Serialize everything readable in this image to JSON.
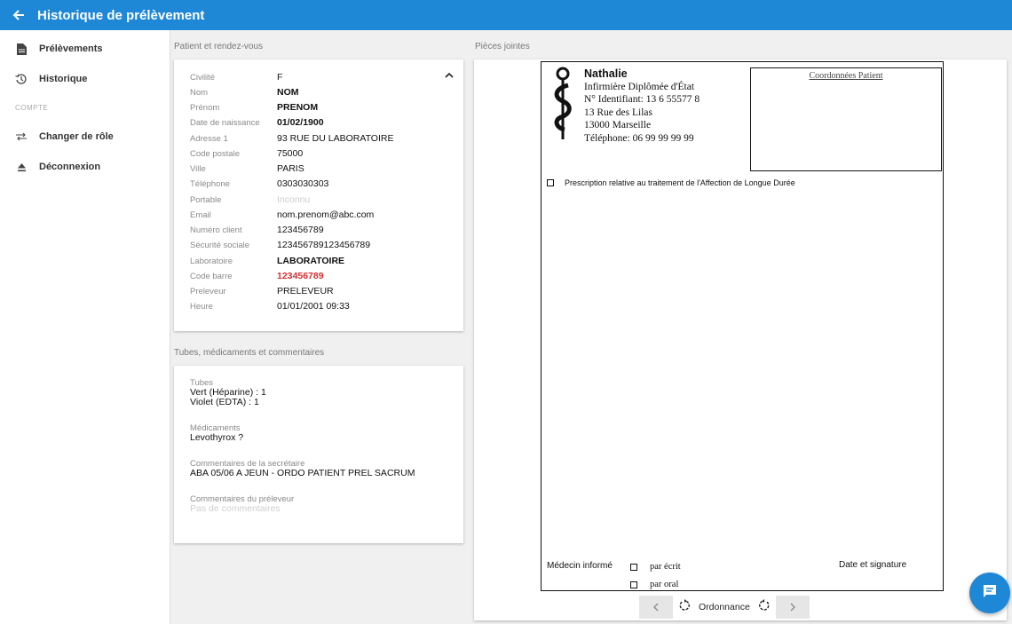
{
  "app": {
    "title": "Historique de prélèvement"
  },
  "sidebar": {
    "items": [
      {
        "label": "Prélèvements",
        "icon": "document-icon"
      },
      {
        "label": "Historique",
        "icon": "history-icon"
      }
    ],
    "section": "COMPTE",
    "account_items": [
      {
        "label": "Changer de rôle",
        "icon": "swap-icon"
      },
      {
        "label": "Déconnexion",
        "icon": "eject-icon"
      }
    ]
  },
  "patient": {
    "section_title": "Patient et rendez-vous",
    "fields": [
      {
        "label": "Civilité",
        "value": "F"
      },
      {
        "label": "Nom",
        "value": "NOM"
      },
      {
        "label": "Prénom",
        "value": "PRENOM"
      },
      {
        "label": "Date de naissance",
        "value": "01/02/1900"
      },
      {
        "label": "Adresse 1",
        "value": "93 RUE DU LABORATOIRE"
      },
      {
        "label": "Code postale",
        "value": "75000"
      },
      {
        "label": "Ville",
        "value": "PARIS"
      },
      {
        "label": "Téléphone",
        "value": "0303030303"
      },
      {
        "label": "Portable",
        "value": "Inconnu"
      },
      {
        "label": "Email",
        "value": "nom.prenom@abc.com"
      },
      {
        "label": "Numéro client",
        "value": "123456789"
      },
      {
        "label": "Sécurité sociale",
        "value": "123456789123456789"
      },
      {
        "label": "Laboratoire",
        "value": "LABORATOIRE"
      },
      {
        "label": "Code barre",
        "value": "123456789"
      },
      {
        "label": "Preleveur",
        "value": "PRELEVEUR"
      },
      {
        "label": "Heure",
        "value": "01/01/2001 09:33"
      }
    ]
  },
  "tubes": {
    "section_title": "Tubes, médicaments et commentaires",
    "tubes_label": "Tubes",
    "tube_lines": [
      "Vert (Héparine) : 1",
      "Violet (EDTA) : 1"
    ],
    "meds_label": "Médicaments",
    "meds_value": "Levothyrox ?",
    "secretary_label": "Commentaires de la secrétaire",
    "secretary_value": "ABA 05/06 A JEUN - ORDO PATIENT PREL SACRUM",
    "preleveur_label": "Commentaires du préleveur",
    "preleveur_value": "Pas de commentaires"
  },
  "attachments": {
    "section_title": "Pièces jointes",
    "document": {
      "nurse_name": "Nathalie",
      "nurse_lines": [
        "Infirmière Diplômée d'État",
        "N° Identifiant: 13 6 55577 8",
        "13 Rue des Lilas",
        "13000 Marseille",
        "Téléphone: 06 99 99 99 99"
      ],
      "patient_box_title": "Coordonnées Patient",
      "ald_text": "Prescription relative au traitement de l'Affection de Longue Durée",
      "medecin_label": "Médecin informé",
      "option_written": "par écrit",
      "option_oral": "par oral",
      "signature_label": "Date et signature"
    },
    "pager": {
      "label": "Ordonnance"
    }
  },
  "colors": {
    "primary": "#1e88d6",
    "barcode_red": "#d32f2f"
  }
}
